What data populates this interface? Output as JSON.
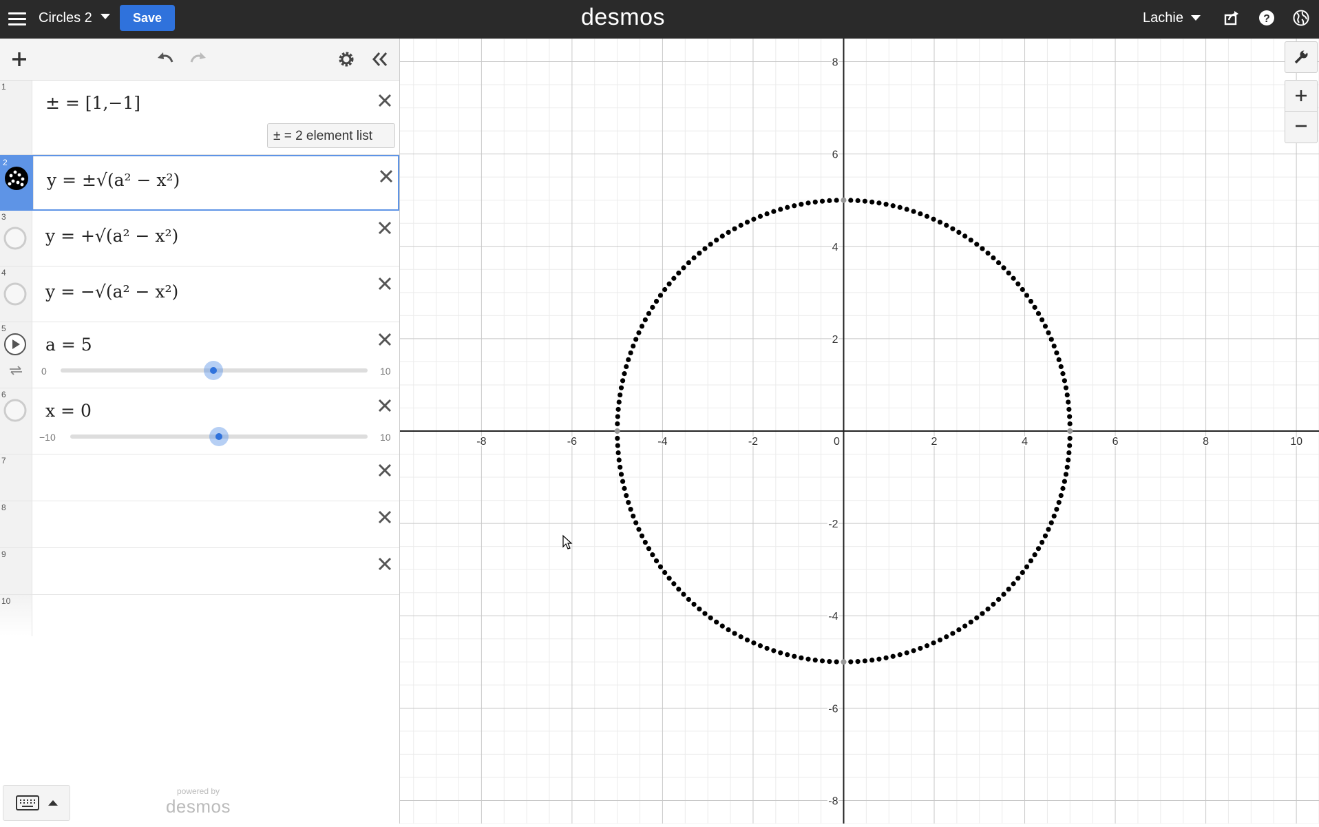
{
  "topbar": {
    "title": "Circles 2",
    "save_label": "Save",
    "brand": "desmos",
    "user": "Lachie"
  },
  "expressions": [
    {
      "num": "1",
      "math": "± = [1,−1]",
      "info": "±  =  2 element list"
    },
    {
      "num": "2",
      "math": "y = ±√(a² − x²)",
      "selected": true
    },
    {
      "num": "3",
      "math": "y = +√(a² − x²)"
    },
    {
      "num": "4",
      "math": "y = −√(a² − x²)"
    },
    {
      "num": "5",
      "math": "a = 5",
      "slider": {
        "min": "0",
        "max": "10",
        "value": 5
      }
    },
    {
      "num": "6",
      "math": "x = 0",
      "slider": {
        "min": "−10",
        "max": "10",
        "value": 0
      }
    },
    {
      "num": "7"
    },
    {
      "num": "8"
    },
    {
      "num": "9"
    },
    {
      "num": "10"
    }
  ],
  "footer": {
    "powered_by": "powered by",
    "brand": "desmos"
  },
  "chart_data": {
    "type": "scatter",
    "xlim": [
      -9.8,
      10.5
    ],
    "ylim": [
      -8.5,
      8.5
    ],
    "grid": true,
    "x_ticks": [
      -8,
      -6,
      -4,
      -2,
      0,
      2,
      4,
      6,
      8,
      10
    ],
    "y_ticks": [
      -8,
      -6,
      -4,
      -2,
      2,
      4,
      6,
      8
    ],
    "series": [
      {
        "circle": {
          "cx": 0,
          "cy": 0,
          "r": 5
        },
        "point_count": 200,
        "color": "#000000"
      }
    ]
  },
  "colors": {
    "accent": "#2f72dc",
    "selected": "#5e94e6",
    "topbar": "#2a2a2a"
  }
}
